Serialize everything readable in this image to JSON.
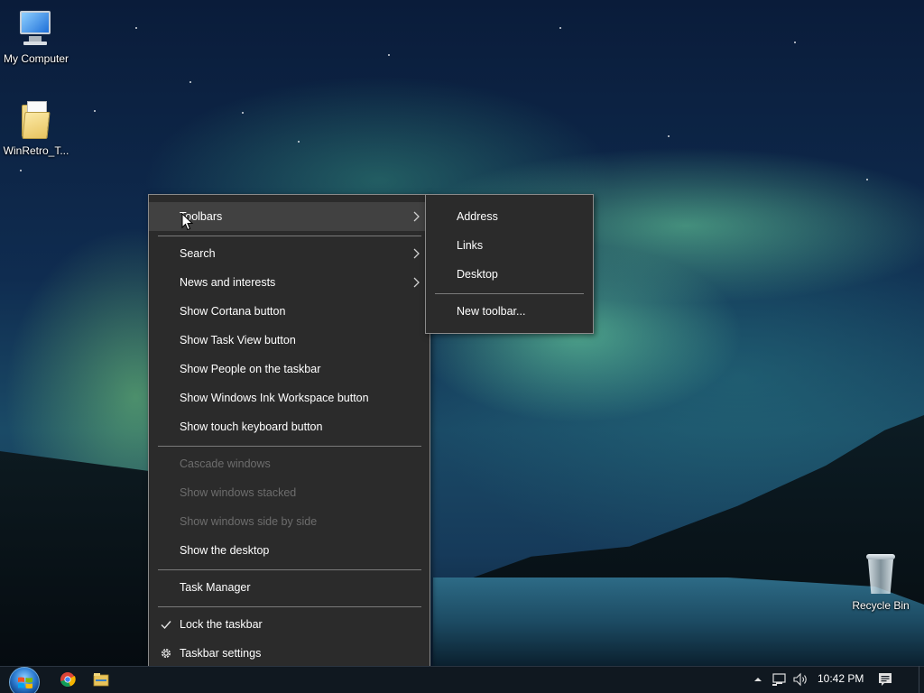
{
  "desktop": {
    "icons": [
      {
        "label": "My Computer",
        "icon": "computer-icon"
      },
      {
        "label": "WinRetro_T...",
        "icon": "folder-icon"
      },
      {
        "label": "Recycle Bin",
        "icon": "recycle-bin-icon"
      }
    ]
  },
  "context_menu": {
    "items": [
      {
        "label": "Toolbars",
        "submenu": true,
        "highlighted": true
      },
      {
        "label": "Search",
        "submenu": true
      },
      {
        "label": "News and interests",
        "submenu": true
      },
      {
        "label": "Show Cortana button"
      },
      {
        "label": "Show Task View button"
      },
      {
        "label": "Show People on the taskbar"
      },
      {
        "label": "Show Windows Ink Workspace button"
      },
      {
        "label": "Show touch keyboard button"
      },
      {
        "label": "Cascade windows",
        "disabled": true
      },
      {
        "label": "Show windows stacked",
        "disabled": true
      },
      {
        "label": "Show windows side by side",
        "disabled": true
      },
      {
        "label": "Show the desktop"
      },
      {
        "label": "Task Manager"
      },
      {
        "label": "Lock the taskbar",
        "checked": true,
        "icon": "checkmark-icon"
      },
      {
        "label": "Taskbar settings",
        "icon": "gear-icon"
      }
    ]
  },
  "toolbars_submenu": {
    "items": [
      {
        "label": "Address"
      },
      {
        "label": "Links"
      },
      {
        "label": "Desktop"
      },
      {
        "label": "New toolbar..."
      }
    ]
  },
  "taskbar": {
    "pinned": [
      "start-button",
      "chrome-icon",
      "file-explorer-icon"
    ],
    "tray_icons": [
      "show-hidden-icons-chevron",
      "network-icon",
      "volume-icon"
    ],
    "clock": "10:42 PM",
    "notification_icon": "action-center-icon"
  },
  "colors": {
    "menu_bg": "#2b2b2b",
    "menu_highlight": "#414141",
    "menu_disabled_text": "#6d6d6d",
    "taskbar_bg": "#101820"
  }
}
